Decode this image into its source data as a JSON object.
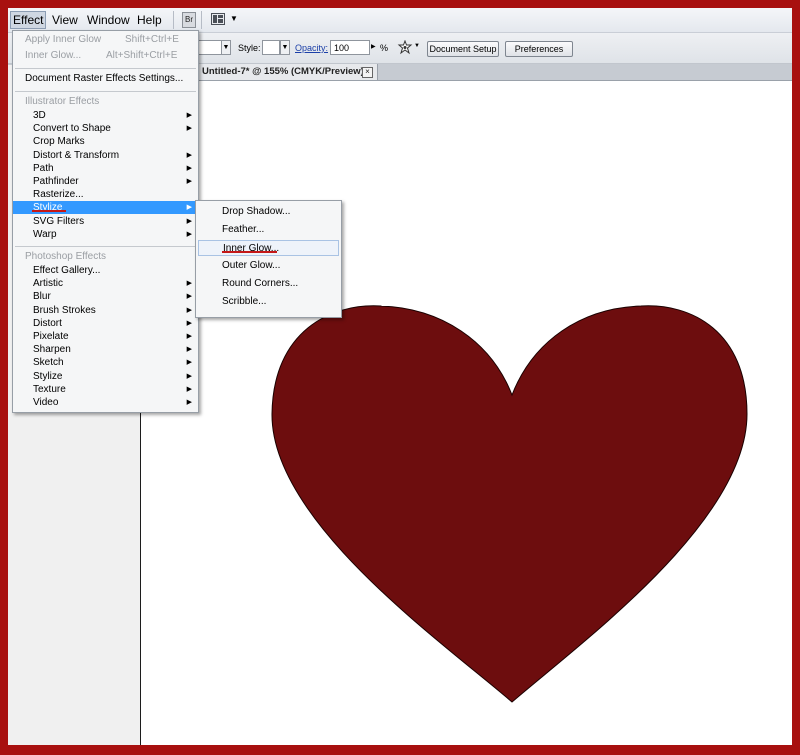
{
  "menubar": {
    "items": [
      "Effect",
      "View",
      "Window",
      "Help"
    ],
    "bridge_label": "Br"
  },
  "controlbar": {
    "style_label": "Style:",
    "opacity_label": "Opacity:",
    "opacity_value": "100",
    "percent": "%",
    "document_setup": "Document Setup",
    "preferences": "Preferences"
  },
  "document": {
    "tab_title": "Untitled-7* @ 155% (CMYK/Preview)",
    "close_glyph": "×"
  },
  "effect_menu": {
    "apply_last": {
      "label": "Apply Inner Glow",
      "shortcut": "Shift+Ctrl+E"
    },
    "last_effect": {
      "label": "Inner Glow...",
      "shortcut": "Alt+Shift+Ctrl+E"
    },
    "raster_settings": "Document Raster Effects Settings...",
    "illustrator_header": "Illustrator Effects",
    "illustrator_items": [
      "3D",
      "Convert to Shape",
      "Crop Marks",
      "Distort & Transform",
      "Path",
      "Pathfinder",
      "Rasterize...",
      "Stylize",
      "SVG Filters",
      "Warp"
    ],
    "photoshop_header": "Photoshop Effects",
    "photoshop_items": [
      "Effect Gallery...",
      "Artistic",
      "Blur",
      "Brush Strokes",
      "Distort",
      "Pixelate",
      "Sharpen",
      "Sketch",
      "Stylize",
      "Texture",
      "Video"
    ]
  },
  "stylize_submenu": {
    "items": [
      "Drop Shadow...",
      "Feather...",
      "Inner Glow...",
      "Outer Glow...",
      "Round Corners...",
      "Scribble..."
    ]
  },
  "colors": {
    "outer_frame": "#a8100f",
    "heart_fill": "#6d0d0e",
    "menu_highlight": "#3399ff",
    "annotation_underline": "#c41818"
  },
  "icons": {
    "submenu_arrow": "▶",
    "dropdown_arrow": "▼"
  }
}
